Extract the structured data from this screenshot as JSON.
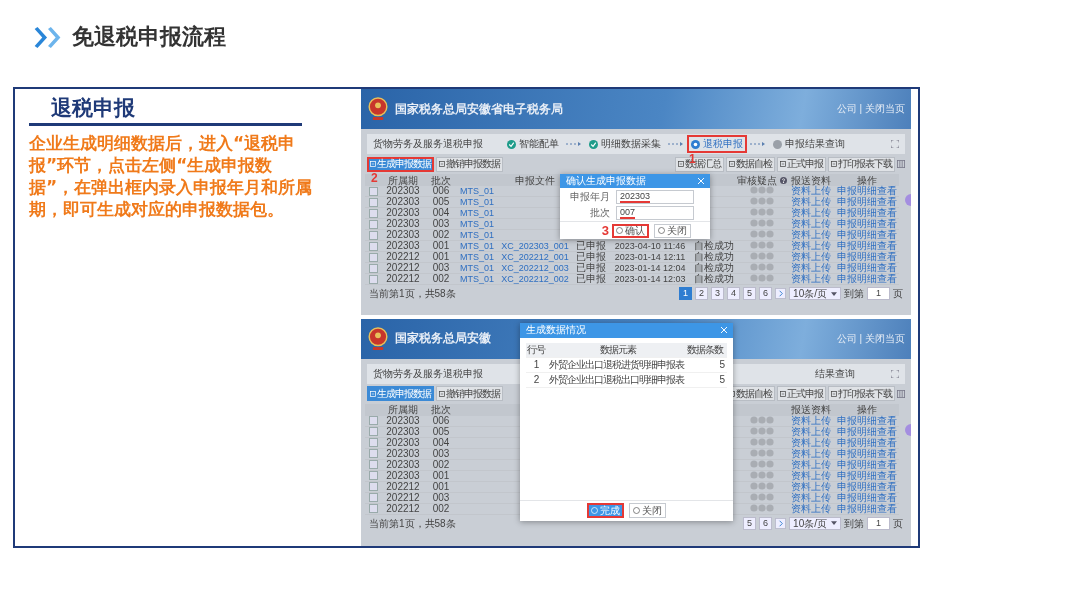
{
  "slide": {
    "title": "免退税申报流程"
  },
  "panel": {
    "heading": "退税申报",
    "description": "企业生成明细数据后，进入“退税申报”环节，点击左侧“生成申报数据”，在弹出框内录入申报年月和所属期，即可生成对应的申报数据包。"
  },
  "screens": [
    {
      "banner": {
        "title": "国家税务总局安徽省电子税务局",
        "links": "公司 | 关闭当页"
      },
      "breadcrumb": "货物劳务及服务退税申报",
      "steps": [
        {
          "label": "智能配单",
          "done": true,
          "current": false,
          "highlighted": false
        },
        {
          "label": "明细数据采集",
          "done": true,
          "current": false,
          "highlighted": false
        },
        {
          "label": "退税申报",
          "done": false,
          "current": true,
          "highlighted": true,
          "marker": "1"
        },
        {
          "label": "申报结果查询",
          "done": false,
          "current": false,
          "highlighted": false
        }
      ],
      "toolbar_left": [
        {
          "label": "生成申报数据",
          "primary": true,
          "highlighted": true,
          "marker": "2"
        },
        {
          "label": "撤销申报数据",
          "primary": false,
          "highlighted": false
        }
      ],
      "toolbar_right": [
        {
          "label": "数据汇总",
          "primary": false,
          "highlighted": false
        },
        {
          "label": "数据自检",
          "primary": false,
          "highlighted": false
        },
        {
          "label": "正式申报",
          "primary": false,
          "highlighted": false
        },
        {
          "label": "打印报表下载",
          "primary": false,
          "highlighted": false
        }
      ],
      "columns": [
        {
          "kind": "text",
          "label": "所属期"
        },
        {
          "kind": "text",
          "label": "批次"
        },
        {
          "kind": "file"
        },
        {
          "kind": "file",
          "label": "申报文件"
        },
        {
          "kind": "text"
        },
        {
          "kind": "date"
        },
        {
          "kind": "text"
        },
        {
          "kind": "dots",
          "label": "审核疑点"
        },
        {
          "kind": "link",
          "label": "报送资料"
        },
        {
          "kind": "link",
          "label": "操作"
        }
      ],
      "rows": [
        {
          "checked": false,
          "cells": [
            "202303",
            "006",
            "MTS_01",
            null,
            null,
            null,
            null,
            null,
            "资料上传",
            "申报明细查看"
          ]
        },
        {
          "checked": false,
          "cells": [
            "202303",
            "005",
            "MTS_01",
            null,
            null,
            null,
            null,
            null,
            "资料上传",
            "申报明细查看"
          ]
        },
        {
          "checked": false,
          "cells": [
            "202303",
            "004",
            "MTS_01",
            null,
            null,
            null,
            null,
            null,
            "资料上传",
            "申报明细查看"
          ]
        },
        {
          "checked": false,
          "cells": [
            "202303",
            "003",
            "MTS_01",
            null,
            null,
            null,
            null,
            null,
            "资料上传",
            "申报明细查看"
          ]
        },
        {
          "checked": false,
          "cells": [
            "202303",
            "002",
            "MTS_01",
            null,
            null,
            null,
            null,
            null,
            "资料上传",
            "申报明细查看"
          ]
        },
        {
          "checked": false,
          "cells": [
            "202303",
            "001",
            "MTS_01",
            "XC_202303_001",
            "已申报",
            "2023-04-10 11:46",
            "自检成功",
            null,
            "资料上传",
            "申报明细查看"
          ]
        },
        {
          "checked": false,
          "cells": [
            "202212",
            "001",
            "MTS_01",
            "XC_202212_001",
            "已申报",
            "2023-01-14 12:11",
            "自检成功",
            null,
            "资料上传",
            "申报明细查看"
          ]
        },
        {
          "checked": false,
          "cells": [
            "202212",
            "003",
            "MTS_01",
            "XC_202212_003",
            "已申报",
            "2023-01-14 12:04",
            "自检成功",
            null,
            "资料上传",
            "申报明细查看"
          ]
        },
        {
          "checked": false,
          "cells": [
            "202212",
            "002",
            "MTS_01",
            "XC_202212_002",
            "已申报",
            "2023-01-14 12:03",
            "自检成功",
            null,
            "资料上传",
            "申报明细查看"
          ]
        }
      ],
      "footer": {
        "summary": "当前第1页，共58条",
        "pages": [
          {
            "label": "1",
            "selected": true
          },
          {
            "label": "2",
            "selected": false
          },
          {
            "label": "3",
            "selected": false
          },
          {
            "label": "4",
            "selected": false
          },
          {
            "label": "5",
            "selected": false
          },
          {
            "label": "6",
            "selected": false
          }
        ],
        "page_size": "10条/页",
        "goto": "到第",
        "goto_value": "1",
        "goto_unit": "页"
      },
      "dialog": {
        "kind": "form",
        "title": "确认生成申报数据",
        "fields": [
          {
            "label": "申报年月",
            "value": "202303",
            "underlined": true
          },
          {
            "label": "批次",
            "value": "007",
            "underlined": true
          }
        ],
        "buttons": [
          {
            "label": "确认",
            "primary": false,
            "highlighted": true,
            "marker": "3"
          },
          {
            "label": "关闭",
            "primary": false,
            "highlighted": false
          }
        ]
      }
    },
    {
      "banner": {
        "title": "国家税务总局安徽",
        "links": "公司 | 关闭当页"
      },
      "breadcrumb": "货物劳务及服务退税申报",
      "steps_tail": "结果查询",
      "toolbar_left": [
        {
          "label": "生成申报数据",
          "primary": true,
          "highlighted": false
        },
        {
          "label": "撤销申报数据",
          "primary": false,
          "highlighted": false
        }
      ],
      "toolbar_right": [
        {
          "label": "数据自检",
          "primary": false,
          "highlighted": false
        },
        {
          "label": "正式申报",
          "primary": false,
          "highlighted": false
        },
        {
          "label": "打印报表下载",
          "primary": false,
          "highlighted": false
        }
      ],
      "columns": [
        {
          "kind": "text",
          "label": "所属期"
        },
        {
          "kind": "text",
          "label": "批次"
        },
        {
          "kind": "file"
        },
        {
          "kind": "file"
        },
        {
          "kind": "text"
        },
        {
          "kind": "date"
        },
        {
          "kind": "text"
        },
        {
          "kind": "dots"
        },
        {
          "kind": "link",
          "label": "报送资料"
        },
        {
          "kind": "link",
          "label": "操作"
        }
      ],
      "rows": [
        {
          "checked": false,
          "cells": [
            "202303",
            "006",
            null,
            null,
            null,
            null,
            null,
            null,
            "资料上传",
            "申报明细查看"
          ]
        },
        {
          "checked": false,
          "cells": [
            "202303",
            "005",
            null,
            null,
            null,
            null,
            null,
            null,
            "资料上传",
            "申报明细查看"
          ]
        },
        {
          "checked": false,
          "cells": [
            "202303",
            "004",
            null,
            null,
            null,
            null,
            null,
            null,
            "资料上传",
            "申报明细查看"
          ]
        },
        {
          "checked": false,
          "cells": [
            "202303",
            "003",
            null,
            null,
            null,
            null,
            null,
            null,
            "资料上传",
            "申报明细查看"
          ]
        },
        {
          "checked": false,
          "cells": [
            "202303",
            "002",
            null,
            null,
            null,
            null,
            null,
            null,
            "资料上传",
            "申报明细查看"
          ]
        },
        {
          "checked": false,
          "cells": [
            "202303",
            "001",
            null,
            null,
            null,
            null,
            null,
            null,
            "资料上传",
            "申报明细查看"
          ]
        },
        {
          "checked": false,
          "cells": [
            "202212",
            "001",
            null,
            null,
            null,
            null,
            null,
            null,
            "资料上传",
            "申报明细查看"
          ]
        },
        {
          "checked": false,
          "cells": [
            "202212",
            "003",
            null,
            null,
            null,
            null,
            null,
            null,
            "资料上传",
            "申报明细查看"
          ]
        },
        {
          "checked": false,
          "cells": [
            "202212",
            "002",
            null,
            null,
            null,
            null,
            null,
            null,
            "资料上传",
            "申报明细查看"
          ]
        }
      ],
      "footer": {
        "summary": "当前第1页，共58条",
        "pages": [
          {
            "label": "5",
            "selected": false
          },
          {
            "label": "6",
            "selected": false
          }
        ],
        "page_size": "10条/页",
        "goto": "到第",
        "goto_value": "1",
        "goto_unit": "页"
      },
      "dialog": {
        "kind": "table",
        "title": "生成数据情况",
        "columns": [
          "行号",
          "数据元素",
          "数据条数"
        ],
        "rows": [
          [
            "1",
            "外贸企业出口退税进货明细申报表",
            "5"
          ],
          [
            "2",
            "外贸企业出口退税出口明细申报表",
            "5"
          ]
        ],
        "buttons": [
          {
            "label": "完成",
            "primary": true,
            "highlighted": true
          },
          {
            "label": "关闭",
            "primary": false,
            "highlighted": false
          }
        ]
      }
    }
  ]
}
